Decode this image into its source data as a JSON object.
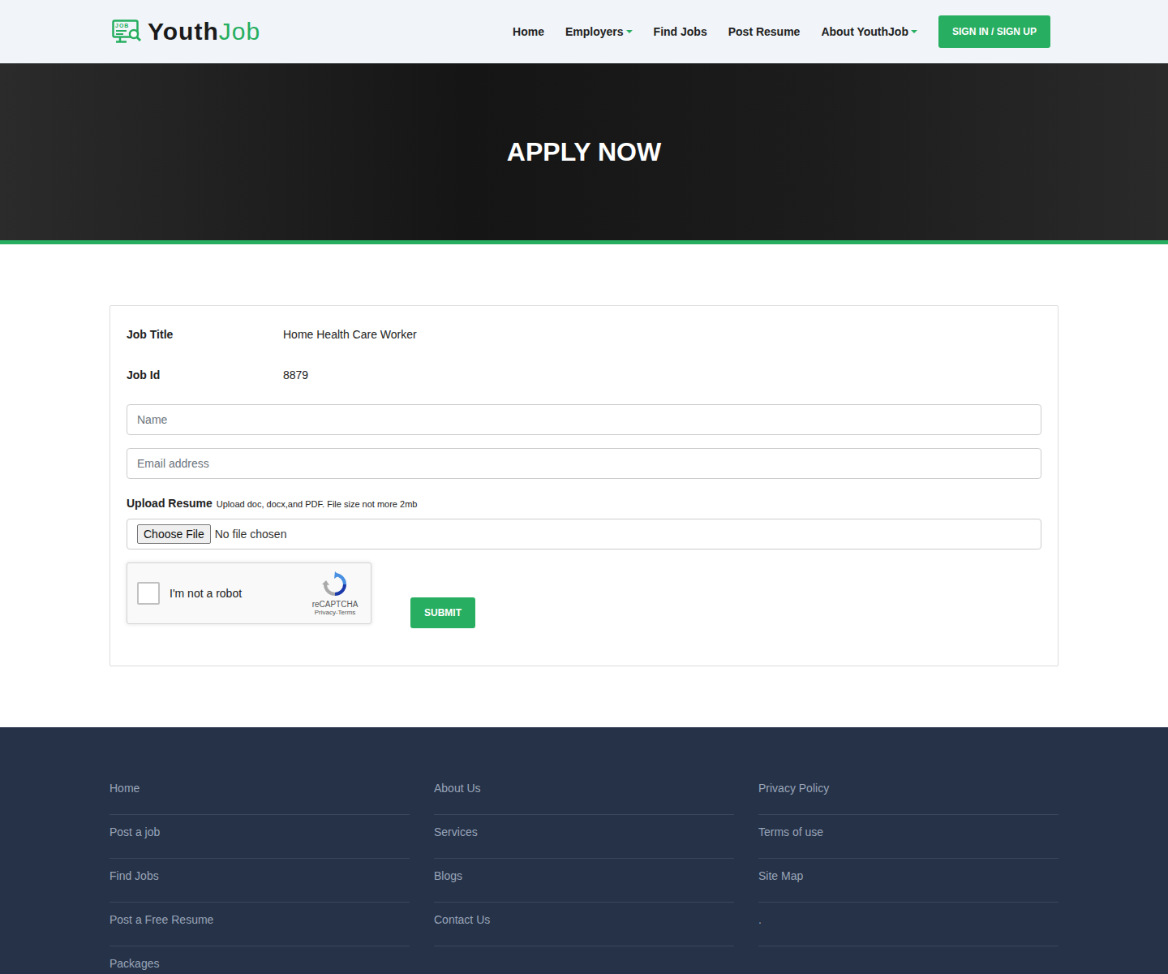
{
  "header": {
    "logo": {
      "icon_text": "JOB",
      "part1": "Youth",
      "part2": "Job"
    },
    "nav": [
      {
        "label": "Home",
        "dropdown": false
      },
      {
        "label": "Employers",
        "dropdown": true
      },
      {
        "label": "Find Jobs",
        "dropdown": false
      },
      {
        "label": "Post Resume",
        "dropdown": false
      },
      {
        "label": "About YouthJob",
        "dropdown": true
      }
    ],
    "auth_button": "SIGN IN / SIGN UP"
  },
  "hero": {
    "title": "APPLY NOW"
  },
  "form": {
    "details": [
      {
        "label": "Job Title",
        "value": "Home Health Care Worker"
      },
      {
        "label": "Job Id",
        "value": "8879"
      }
    ],
    "name_placeholder": "Name",
    "email_placeholder": "Email address",
    "upload_label": "Upload Resume",
    "upload_note": "Upload doc, docx,and PDF. File size not more 2mb",
    "file_button": "Choose File",
    "file_status": "No file chosen",
    "captcha": {
      "label": "I'm not a robot",
      "checked": false,
      "brand": "reCAPTCHA",
      "links": [
        "Privacy",
        "Terms"
      ],
      "separator": "-"
    },
    "submit": "SUBMIT"
  },
  "footer": {
    "columns": [
      [
        "Home",
        "Post a job",
        "Find Jobs",
        "Post a Free Resume",
        "Packages"
      ],
      [
        "About Us",
        "Services",
        "Blogs",
        "Contact Us"
      ],
      [
        "Privacy Policy",
        "Terms of use",
        "Site Map",
        "."
      ]
    ]
  }
}
